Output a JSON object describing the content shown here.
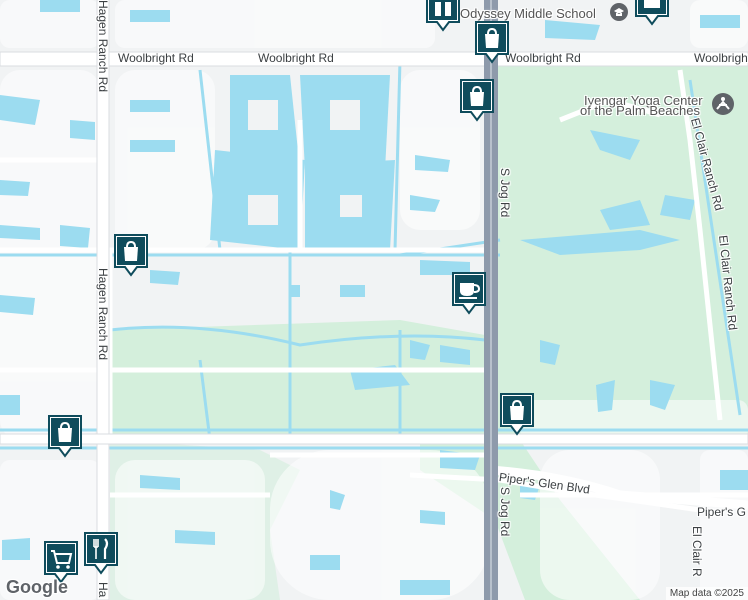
{
  "map": {
    "roads": {
      "woolbright_left": "Woolbright Rd",
      "woolbright_mid": "Woolbright Rd",
      "woolbright_right": "Woolbright Rd",
      "woolbright_far_right": "Woolbright",
      "hagen_top": "Hagen Ranch Rd",
      "hagen_mid": "Hagen Ranch Rd",
      "hagen_bottom": "Ha",
      "jog_top": "S Jog Rd",
      "jog_bottom": "S Jog Rd",
      "el_clair_top": "El Clair Ranch Rd",
      "el_clair_mid": "El Clair Ranch Rd",
      "el_clair_bottom": "El Clair R",
      "pipers_glen": "Piper's Glen Blvd",
      "pipers_right": "Piper's G"
    },
    "places": {
      "odyssey": "Odyssey Middle School",
      "yoga_line1": "Iyengar Yoga Center",
      "yoga_line2": "of the Palm Beaches"
    },
    "pins": [
      {
        "name": "shopping-bag-icon",
        "kind": "shopping"
      },
      {
        "name": "shopping-bag-icon",
        "kind": "shopping"
      },
      {
        "name": "shopping-bag-icon",
        "kind": "shopping"
      },
      {
        "name": "shopping-bag-icon",
        "kind": "shopping"
      },
      {
        "name": "shopping-bag-icon",
        "kind": "shopping"
      },
      {
        "name": "coffee-cup-icon",
        "kind": "cafe"
      },
      {
        "name": "restaurant-icon",
        "kind": "restaurant"
      },
      {
        "name": "shopping-cart-icon",
        "kind": "grocery"
      }
    ],
    "colors": {
      "land": "#f1f3f4",
      "water": "#9cdcf0",
      "park": "#d4efdc",
      "road": "#ffffff",
      "highway": "#8e9aab",
      "pin": "#0f4c5c"
    }
  },
  "footer": {
    "attribution": "Map data ©2025",
    "logo": "Google"
  }
}
